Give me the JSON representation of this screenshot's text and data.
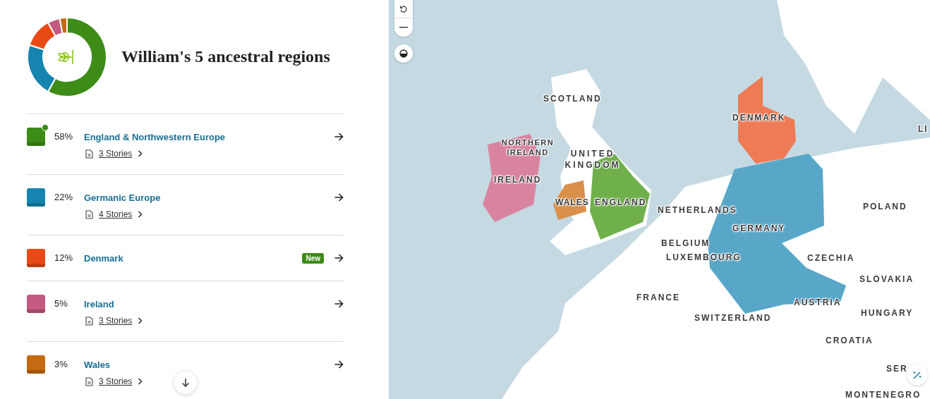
{
  "header": {
    "title": "William's 5 ancestral regions"
  },
  "regions": [
    {
      "percent": "58%",
      "name": "England & Northwestern Europe",
      "color": "#3d8c18",
      "indicator": true,
      "stories": "3 Stories"
    },
    {
      "percent": "22%",
      "name": "Germanic Europe",
      "color": "#1585b0",
      "indicator": false,
      "stories": "4 Stories"
    },
    {
      "percent": "12%",
      "name": "Denmark",
      "color": "#e84a15",
      "indicator": false,
      "badge": "New"
    },
    {
      "percent": "5%",
      "name": "Ireland",
      "color": "#c45a82",
      "indicator": false,
      "stories": "3 Stories"
    },
    {
      "percent": "3%",
      "name": "Wales",
      "color": "#c46a12",
      "indicator": false,
      "stories": "3 Stories"
    }
  ],
  "map": {
    "labels": [
      "SCOTLAND",
      "NORTHERN IRELAND",
      "UNITED KINGDOM",
      "IRELAND",
      "WALES",
      "ENGLAND",
      "DENMARK",
      "NETHERLANDS",
      "GERMANY",
      "BELGIUM",
      "LUXEMBOURG",
      "CZECHIA",
      "POLAND",
      "SLOVAKIA",
      "FRANCE",
      "SWITZERLAND",
      "AUSTRIA",
      "HUNGARY",
      "CROATIA",
      "SER",
      "MONTENEGRO",
      "LI"
    ]
  }
}
